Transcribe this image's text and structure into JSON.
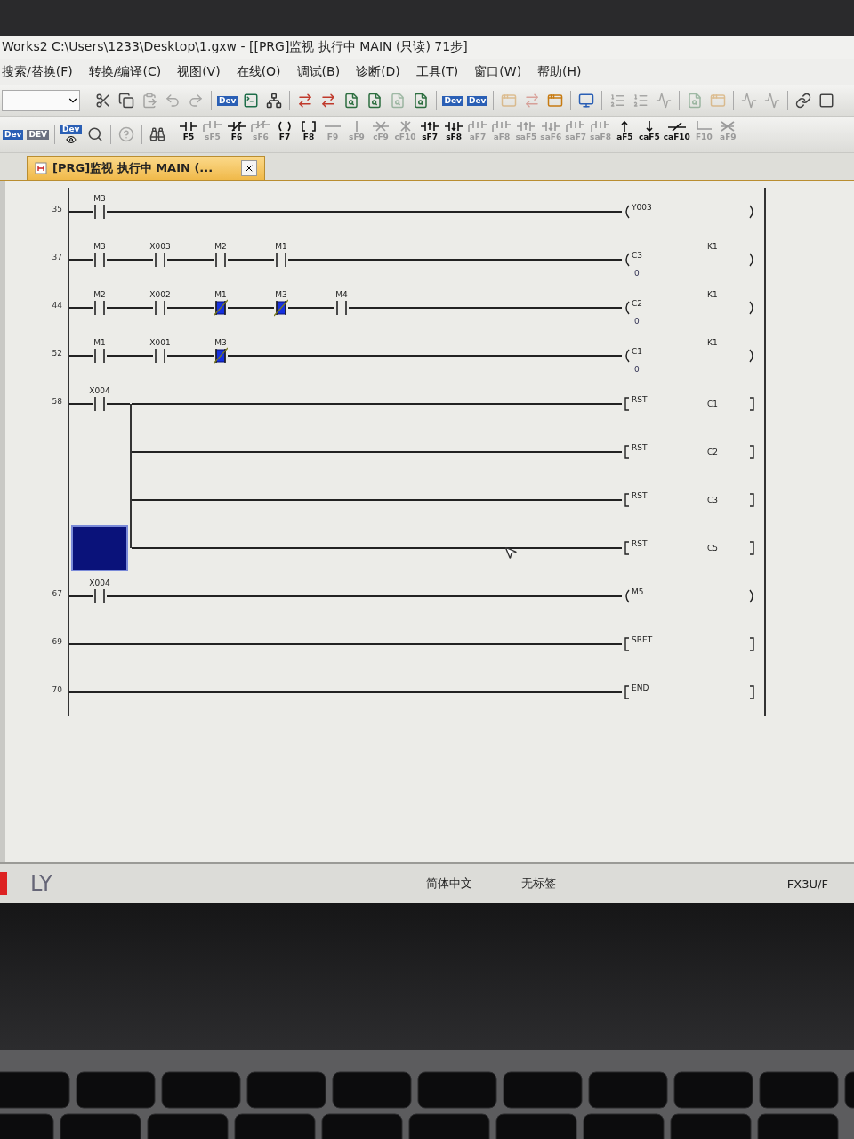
{
  "window": {
    "title": "Works2 C:\\Users\\1233\\Desktop\\1.gxw - [[PRG]监视 执行中 MAIN (只读) 71步]"
  },
  "menu": [
    "搜索/替换(F)",
    "转换/编译(C)",
    "视图(V)",
    "在线(O)",
    "调试(B)",
    "诊断(D)",
    "工具(T)",
    "窗口(W)",
    "帮助(H)"
  ],
  "toolbar_1": [
    {
      "kind": "cut",
      "disabled": false
    },
    {
      "kind": "copy",
      "disabled": false
    },
    {
      "kind": "paste",
      "disabled": true
    },
    {
      "kind": "undo",
      "disabled": true
    },
    {
      "kind": "redo",
      "disabled": true
    },
    {
      "kind": "separator"
    },
    {
      "kind": "dev",
      "caption": "Dev",
      "disabled": false
    },
    {
      "kind": "terminal",
      "disabled": false
    },
    {
      "kind": "network",
      "disabled": false
    },
    {
      "kind": "separator"
    },
    {
      "kind": "arrows",
      "disabled": false
    },
    {
      "kind": "arrows",
      "disabled": false
    },
    {
      "kind": "find",
      "disabled": false
    },
    {
      "kind": "find",
      "disabled": false
    },
    {
      "kind": "find",
      "disabled": true
    },
    {
      "kind": "find",
      "disabled": false
    },
    {
      "kind": "separator"
    },
    {
      "kind": "dev",
      "caption": "Dev",
      "disabled": false
    },
    {
      "kind": "dev",
      "caption": "Dev",
      "disabled": false
    },
    {
      "kind": "separator"
    },
    {
      "kind": "window",
      "disabled": true
    },
    {
      "kind": "arrows",
      "disabled": true
    },
    {
      "kind": "window",
      "disabled": false
    },
    {
      "kind": "separator"
    },
    {
      "kind": "monitor",
      "disabled": false
    },
    {
      "kind": "separator"
    },
    {
      "kind": "list",
      "disabled": true
    },
    {
      "kind": "list",
      "disabled": true
    },
    {
      "kind": "pulse",
      "disabled": true
    },
    {
      "kind": "separator"
    },
    {
      "kind": "find",
      "disabled": true
    },
    {
      "kind": "window",
      "disabled": true
    },
    {
      "kind": "separator"
    },
    {
      "kind": "pulse",
      "disabled": true
    },
    {
      "kind": "pulse",
      "disabled": true
    },
    {
      "kind": "separator"
    },
    {
      "kind": "link",
      "disabled": false
    },
    {
      "kind": "stop",
      "disabled": false
    }
  ],
  "toolbar_2": [
    {
      "kind": "dev",
      "caption": "Dev",
      "disabled": false
    },
    {
      "kind": "dev",
      "caption": "DEV",
      "disabled": true
    },
    {
      "kind": "separator"
    },
    {
      "kind": "dev_eye",
      "caption": "Dev",
      "disabled": false
    },
    {
      "kind": "search",
      "disabled": false
    },
    {
      "kind": "separator"
    },
    {
      "kind": "help",
      "disabled": true
    },
    {
      "kind": "separator"
    },
    {
      "kind": "binoculars",
      "disabled": false
    }
  ],
  "ladder_tools": [
    {
      "caption": "F5",
      "kind": "no",
      "disabled": false
    },
    {
      "caption": "sF5",
      "kind": "por",
      "disabled": true
    },
    {
      "caption": "F6",
      "kind": "nc",
      "disabled": false
    },
    {
      "caption": "sF6",
      "kind": "pnc",
      "disabled": true
    },
    {
      "caption": "F7",
      "kind": "coil",
      "disabled": false
    },
    {
      "caption": "F8",
      "kind": "func",
      "disabled": false
    },
    {
      "caption": "F9",
      "kind": "hline",
      "disabled": true
    },
    {
      "caption": "sF9",
      "kind": "vline",
      "disabled": true
    },
    {
      "caption": "cF9",
      "kind": "hdel",
      "disabled": true
    },
    {
      "caption": "cF10",
      "kind": "vdel",
      "disabled": true
    },
    {
      "caption": "sF7",
      "kind": "rise",
      "disabled": false
    },
    {
      "caption": "sF8",
      "kind": "fall",
      "disabled": false
    },
    {
      "caption": "aF7",
      "kind": "prise",
      "disabled": true
    },
    {
      "caption": "aF8",
      "kind": "pfall",
      "disabled": true
    },
    {
      "caption": "saF5",
      "kind": "rise",
      "disabled": true
    },
    {
      "caption": "saF6",
      "kind": "fall",
      "disabled": true
    },
    {
      "caption": "saF7",
      "kind": "prise",
      "disabled": true
    },
    {
      "caption": "saF8",
      "kind": "pfall",
      "disabled": true
    },
    {
      "caption": "aF5",
      "kind": "up",
      "disabled": false
    },
    {
      "caption": "caF5",
      "kind": "down",
      "disabled": false
    },
    {
      "caption": "caF10",
      "kind": "inv",
      "disabled": false
    },
    {
      "caption": "F10",
      "kind": "hin",
      "disabled": true
    },
    {
      "caption": "aF9",
      "kind": "del",
      "disabled": true
    }
  ],
  "tab": {
    "label": "[PRG]监视 执行中 MAIN (...",
    "selected": true
  },
  "rungs": [
    {
      "step": "35",
      "contacts": [
        {
          "device": "M3",
          "kind": "no",
          "on": false
        }
      ],
      "output": {
        "kind": "coil",
        "device": "Y003"
      }
    },
    {
      "step": "37",
      "contacts": [
        {
          "device": "M3",
          "kind": "no",
          "on": false
        },
        {
          "device": "X003",
          "kind": "no",
          "on": false
        },
        {
          "device": "M2",
          "kind": "no",
          "on": false
        },
        {
          "device": "M1",
          "kind": "no",
          "on": false
        }
      ],
      "output": {
        "kind": "counter",
        "device": "C3",
        "setting": "K1",
        "current": "0"
      }
    },
    {
      "step": "44",
      "contacts": [
        {
          "device": "M2",
          "kind": "no",
          "on": false
        },
        {
          "device": "X002",
          "kind": "no",
          "on": false
        },
        {
          "device": "M1",
          "kind": "nc",
          "on": true
        },
        {
          "device": "M3",
          "kind": "nc",
          "on": true
        },
        {
          "device": "M4",
          "kind": "no",
          "on": false
        }
      ],
      "output": {
        "kind": "counter",
        "device": "C2",
        "setting": "K1",
        "current": "0"
      }
    },
    {
      "step": "52",
      "contacts": [
        {
          "device": "M1",
          "kind": "no",
          "on": false
        },
        {
          "device": "X001",
          "kind": "no",
          "on": false
        },
        {
          "device": "M3",
          "kind": "nc",
          "on": true
        }
      ],
      "output": {
        "kind": "counter",
        "device": "C1",
        "setting": "K1",
        "current": "0"
      }
    },
    {
      "step": "58",
      "contacts": [
        {
          "device": "X004",
          "kind": "no",
          "on": false
        }
      ],
      "output": {
        "kind": "instruction",
        "name": "RST",
        "operand": "C1"
      },
      "branches": [
        {
          "output": {
            "kind": "instruction",
            "name": "RST",
            "operand": "C2"
          },
          "selected": false
        },
        {
          "output": {
            "kind": "instruction",
            "name": "RST",
            "operand": "C3"
          },
          "selected": false
        },
        {
          "output": {
            "kind": "instruction",
            "name": "RST",
            "operand": "C5"
          },
          "selected": true
        }
      ]
    },
    {
      "step": "67",
      "contacts": [
        {
          "device": "X004",
          "kind": "no",
          "on": false
        }
      ],
      "output": {
        "kind": "coil",
        "device": "M5"
      }
    },
    {
      "step": "69",
      "output": {
        "kind": "instruction",
        "name": "SRET"
      }
    },
    {
      "step": "70",
      "output": {
        "kind": "instruction",
        "name": "END"
      }
    }
  ],
  "status_bar": {
    "user": "LY",
    "language": "简体中文",
    "label": "无标签",
    "plc": "FX3U/F"
  }
}
